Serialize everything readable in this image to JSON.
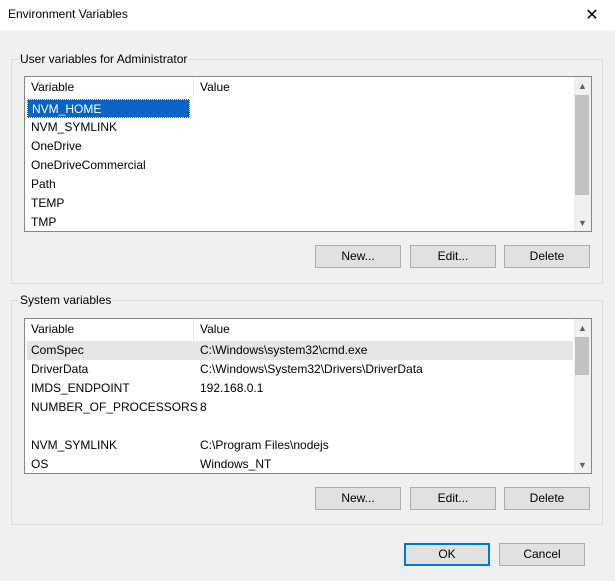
{
  "window": {
    "title": "Environment Variables",
    "close_glyph": "✕"
  },
  "user_section": {
    "label": "User variables for Administrator",
    "columns": {
      "variable": "Variable",
      "value": "Value"
    },
    "rows": [
      {
        "name": "NVM_HOME",
        "value": ""
      },
      {
        "name": "NVM_SYMLINK",
        "value": ""
      },
      {
        "name": "OneDrive",
        "value": ""
      },
      {
        "name": "OneDriveCommercial",
        "value": ""
      },
      {
        "name": "Path",
        "value": ""
      },
      {
        "name": "TEMP",
        "value": ""
      },
      {
        "name": "TMP",
        "value": ""
      }
    ],
    "buttons": {
      "new": "New...",
      "edit": "Edit...",
      "delete": "Delete"
    }
  },
  "system_section": {
    "label": "System variables",
    "columns": {
      "variable": "Variable",
      "value": "Value"
    },
    "rows": [
      {
        "name": "ComSpec",
        "value": "C:\\Windows\\system32\\cmd.exe"
      },
      {
        "name": "DriverData",
        "value": "C:\\Windows\\System32\\Drivers\\DriverData"
      },
      {
        "name": "IMDS_ENDPOINT",
        "value": "192.168.0.1"
      },
      {
        "name": "NUMBER_OF_PROCESSORS",
        "value": "8"
      },
      {
        "name": "",
        "value": ""
      },
      {
        "name": "NVM_SYMLINK",
        "value": "C:\\Program Files\\nodejs"
      },
      {
        "name": "OS",
        "value": "Windows_NT"
      }
    ],
    "buttons": {
      "new": "New...",
      "edit": "Edit...",
      "delete": "Delete"
    }
  },
  "footer": {
    "ok": "OK",
    "cancel": "Cancel"
  },
  "icons": {
    "scroll_up": "▲",
    "scroll_down": "▼"
  },
  "colors": {
    "selection": "#0a64c8",
    "accent": "#0078d7"
  }
}
